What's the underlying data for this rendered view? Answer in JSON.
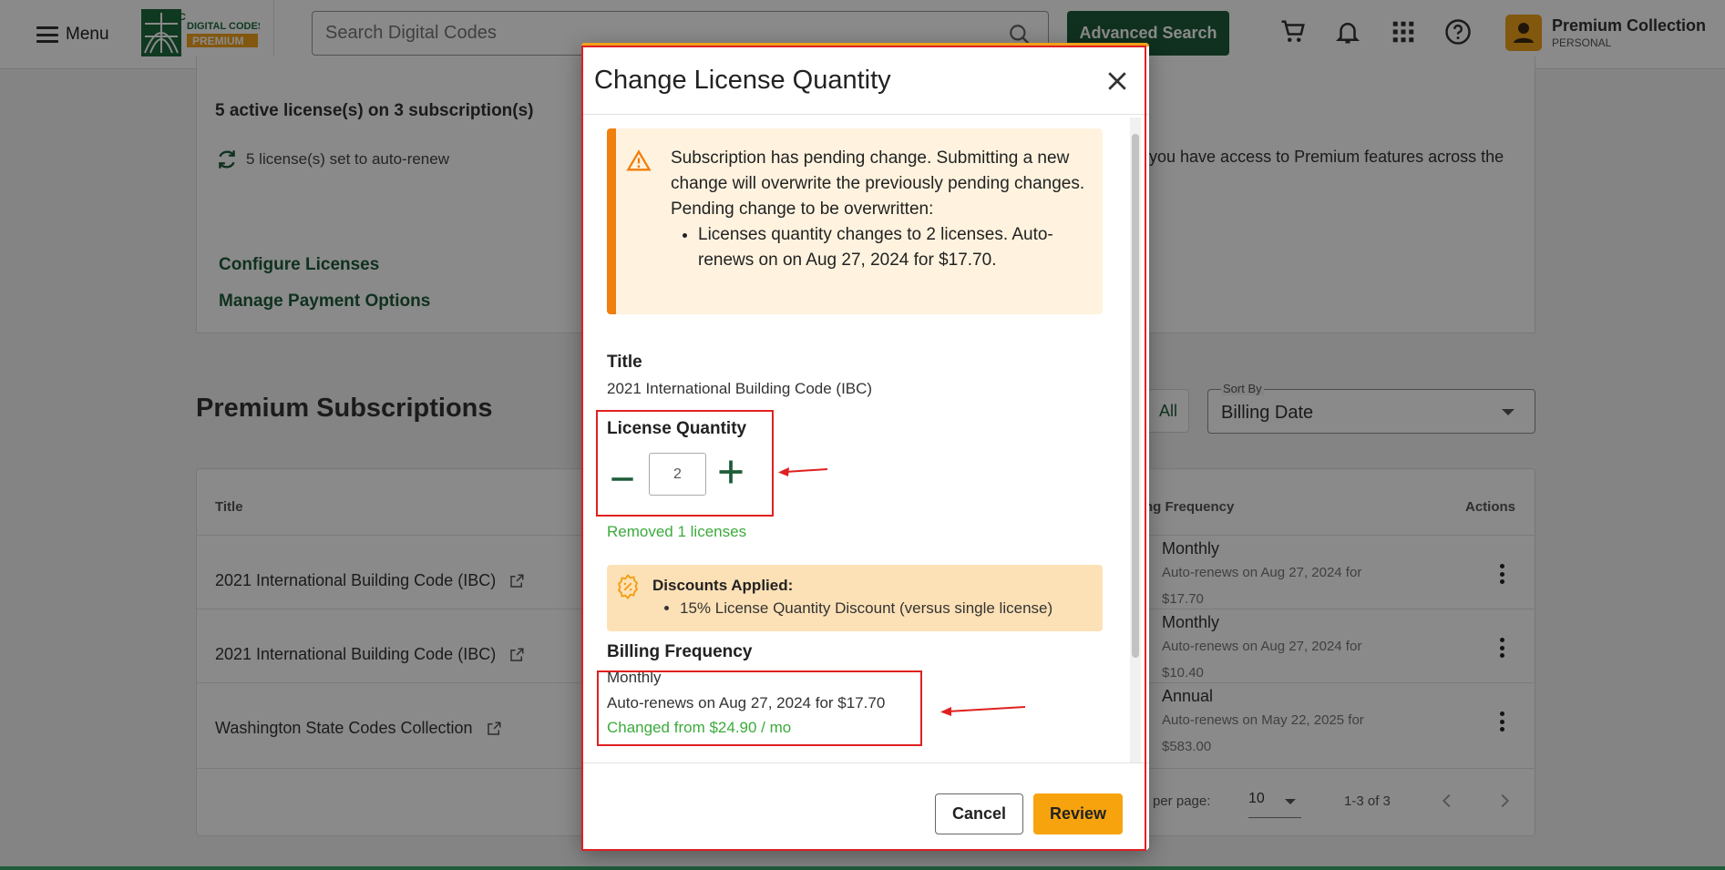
{
  "header": {
    "menu_label": "Menu",
    "logo_top": "ICC",
    "logo_line1": "DIGITAL CODES",
    "logo_line2": "PREMIUM",
    "search_placeholder": "Search Digital Codes",
    "advanced_search_label": "Advanced Search",
    "icons": [
      "cart-icon",
      "bell-icon",
      "apps-grid-icon",
      "help-icon"
    ],
    "user_name": "Premium Collection",
    "user_type": "PERSONAL"
  },
  "summary": {
    "active_licenses": "5 active license(s) on 3 subscription(s)",
    "auto_renew": "5 license(s) set to auto-renew",
    "premium_access_text": "you have access to Premium features across the",
    "configure_licenses": "Configure Licenses",
    "manage_payment": "Manage Payment Options"
  },
  "subscriptions": {
    "section_title": "Premium Subscriptions",
    "filter_all": "All",
    "sort_label": "Sort By",
    "sort_value": "Billing Date",
    "columns": {
      "title": "Title",
      "frequency": "ng Frequency",
      "actions": "Actions"
    },
    "rows": [
      {
        "title": "2021 International Building Code (IBC)",
        "frequency": "Monthly",
        "renew_line1": "Auto-renews on Aug 27, 2024 for",
        "renew_line2": "$17.70"
      },
      {
        "title": "2021 International Building Code (IBC)",
        "frequency": "Monthly",
        "renew_line1": "Auto-renews on Aug 27, 2024 for",
        "renew_line2": "$10.40"
      },
      {
        "title": "Washington State Codes Collection",
        "frequency": "Annual",
        "renew_line1": "Auto-renews on May 22, 2025 for",
        "renew_line2": "$583.00"
      }
    ],
    "pagination": {
      "rows_per_page_label": "per page:",
      "rows_per_page": "10",
      "range": "1-3 of 3"
    }
  },
  "modal": {
    "title": "Change License Quantity",
    "warning": {
      "line1": "Subscription has pending change. Submitting a new change will overwrite the previously pending changes.",
      "line2": "Pending change to be overwritten:",
      "bullet": "Licenses quantity changes to 2 licenses. Auto-renews on on Aug 27, 2024 for $17.70."
    },
    "title_label": "Title",
    "title_value": "2021 International Building Code (IBC)",
    "quantity_label": "License Quantity",
    "quantity_value": "2",
    "quantity_change": "Removed 1 licenses",
    "discounts_header": "Discounts Applied:",
    "discount_item": "15% License Quantity Discount (versus single license)",
    "billing_label": "Billing Frequency",
    "billing_value": "Monthly",
    "billing_renew": "Auto-renews on Aug 27, 2024 for $17.70",
    "billing_change": "Changed from $24.90 / mo",
    "partial_heading": "...",
    "cancel_label": "Cancel",
    "review_label": "Review"
  },
  "colors": {
    "brand_green": "#1e5c3a",
    "accent_orange": "#f7a30e",
    "warning_bar": "#f07f0d",
    "success_green": "#3bab3b",
    "annotation_red": "#e02020"
  }
}
